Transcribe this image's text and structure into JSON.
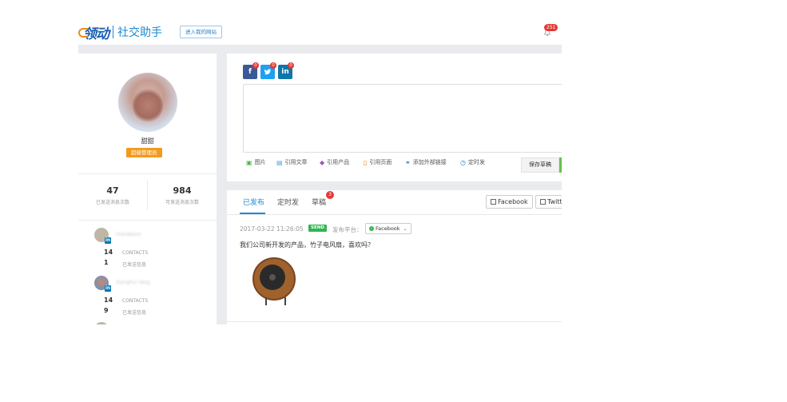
{
  "header": {
    "logo_mark": "领动",
    "logo_text": "社交助手",
    "site_button": "进入我的网站",
    "notification_count": "251"
  },
  "profile": {
    "name": "甜甜",
    "role": "超级管理员",
    "stats": [
      {
        "value": "47",
        "label": "已发送消息次数"
      },
      {
        "value": "984",
        "label": "可发送消息次数"
      }
    ],
    "contacts": [
      {
        "name": "rHardware",
        "contacts": "14",
        "contacts_label": "CONTACTS",
        "sent": "1",
        "sent_label": "已发送信息"
      },
      {
        "name": "Xianghui Yang",
        "contacts": "14",
        "contacts_label": "CONTACTS",
        "sent": "9",
        "sent_label": "已发送信息"
      }
    ]
  },
  "composer": {
    "social_buttons": [
      {
        "name": "facebook",
        "glyph": "f",
        "count": "0",
        "color": "#3b5998"
      },
      {
        "name": "twitter",
        "glyph": "t",
        "count": "0",
        "color": "#1da1f2"
      },
      {
        "name": "linkedin",
        "glyph": "in",
        "count": "0",
        "color": "#0e76a8"
      }
    ],
    "tools": {
      "image": "图片",
      "cite_article": "引用文章",
      "cite_product": "引用产品",
      "cite_page": "引用页面",
      "add_link": "添加外部链接",
      "schedule": "定时发"
    },
    "save_draft": "保存草稿"
  },
  "feed": {
    "tabs": {
      "published": "已发布",
      "scheduled": "定时发",
      "drafts": "草稿",
      "drafts_badge": "3"
    },
    "filters": {
      "facebook": "Facebook",
      "twitter": "Twitt"
    },
    "post": {
      "date": "2017-03-22 11:26:05",
      "status": "SEND",
      "platform_label": "发布平台：",
      "platform": "Facebook",
      "text": "我们公司新开发的产品，竹子电风扇，喜欢吗？"
    }
  }
}
